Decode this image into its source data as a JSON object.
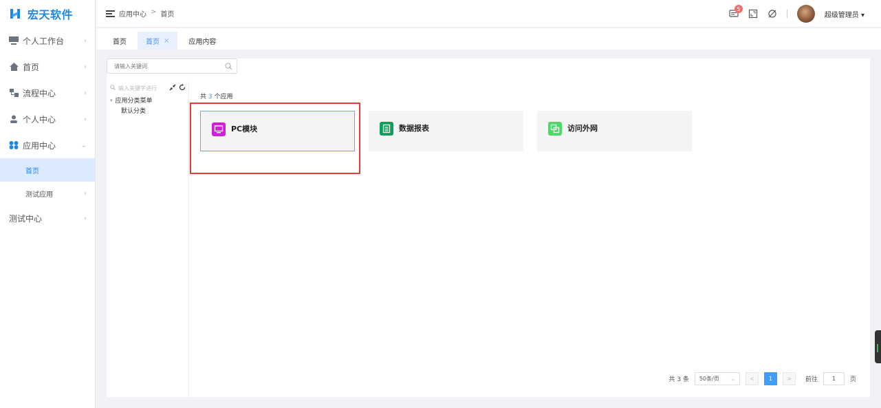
{
  "app": {
    "logo_text": "宏天软件"
  },
  "sidebar": {
    "items": [
      {
        "label": "个人工作台",
        "icon": "monitor-icon"
      },
      {
        "label": "首页",
        "icon": "home-icon"
      },
      {
        "label": "流程中心",
        "icon": "flow-icon"
      },
      {
        "label": "个人中心",
        "icon": "user-icon"
      },
      {
        "label": "应用中心",
        "icon": "apps-icon"
      }
    ],
    "sub_items": [
      {
        "label": "首页",
        "active": true
      },
      {
        "label": "测试应用",
        "active": false
      }
    ],
    "bottom_item": {
      "label": "测试中心"
    }
  },
  "header": {
    "breadcrumb": [
      "应用中心",
      "首页"
    ],
    "breadcrumb_sep": ">",
    "notification_count": "5",
    "user_name": "超级管理员"
  },
  "tabs": [
    {
      "label": "首页",
      "active": false
    },
    {
      "label": "首页",
      "active": true,
      "close": "×"
    },
    {
      "label": "应用内容",
      "active": false
    }
  ],
  "search": {
    "placeholder": "请输入关键词"
  },
  "tree": {
    "search_placeholder": "输入关键字进行",
    "root": "应用分类菜单",
    "children": [
      "默认分类"
    ]
  },
  "apps": {
    "count_prefix": "共",
    "count": "3",
    "count_suffix": "个应用",
    "cards": [
      {
        "title": "PC模块",
        "icon": "monitor-icon",
        "color": "#d01fd9"
      },
      {
        "title": "数据报表",
        "icon": "document-icon",
        "color": "#0f9d58"
      },
      {
        "title": "访问外网",
        "icon": "copy-icon",
        "color": "#4cd964"
      }
    ]
  },
  "pagination": {
    "total": "共 3 条",
    "page_size": "50条/页",
    "prev": "<",
    "current": "1",
    "next": ">",
    "goto_label": "前往",
    "goto_value": "1",
    "goto_suffix": "页"
  },
  "colors": {
    "brand": "#1e88e5",
    "accent": "#409eff",
    "highlight": "#e53935"
  }
}
